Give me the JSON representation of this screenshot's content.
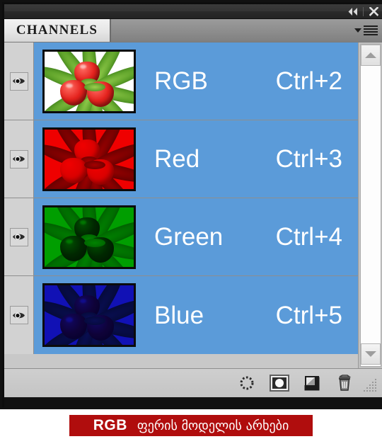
{
  "window": {
    "titlebar": {
      "collapse_icon": "double-left-arrow-icon",
      "close_icon": "close-x-icon"
    }
  },
  "panel": {
    "tab_label": "CHANNELS",
    "menu_icon": "panel-menu-icon"
  },
  "channels": [
    {
      "name": "RGB",
      "shortcut": "Ctrl+2",
      "visible": true,
      "selected": true,
      "eye_icon": "eye-icon",
      "thumbnail": "strawberries-rgb-composite",
      "thumb_mode": "rgb"
    },
    {
      "name": "Red",
      "shortcut": "Ctrl+3",
      "visible": true,
      "selected": true,
      "eye_icon": "eye-icon",
      "thumbnail": "strawberries-red-channel",
      "thumb_mode": "red"
    },
    {
      "name": "Green",
      "shortcut": "Ctrl+4",
      "visible": true,
      "selected": true,
      "eye_icon": "eye-icon",
      "thumbnail": "strawberries-green-channel",
      "thumb_mode": "green"
    },
    {
      "name": "Blue",
      "shortcut": "Ctrl+5",
      "visible": true,
      "selected": true,
      "eye_icon": "eye-icon",
      "thumbnail": "strawberries-blue-channel",
      "thumb_mode": "blue"
    }
  ],
  "scrollbar": {
    "up_icon": "chevron-up-icon",
    "down_icon": "chevron-down-icon"
  },
  "footer": {
    "buttons": [
      {
        "icon": "load-channel-as-selection-icon"
      },
      {
        "icon": "save-selection-as-channel-icon"
      },
      {
        "icon": "new-channel-icon"
      },
      {
        "icon": "delete-channel-icon"
      }
    ],
    "resize_grip": "resize-grip-icon"
  },
  "caption": {
    "prefix": "RGB",
    "text": "ფერის მოდელის არხები",
    "background_color": "#b00d0d",
    "text_color": "#ffffff"
  },
  "colors": {
    "selection_blue": "#5b9bd9",
    "panel_gray": "#c8c8c8",
    "titlebar_dark": "#2e2e2e"
  }
}
